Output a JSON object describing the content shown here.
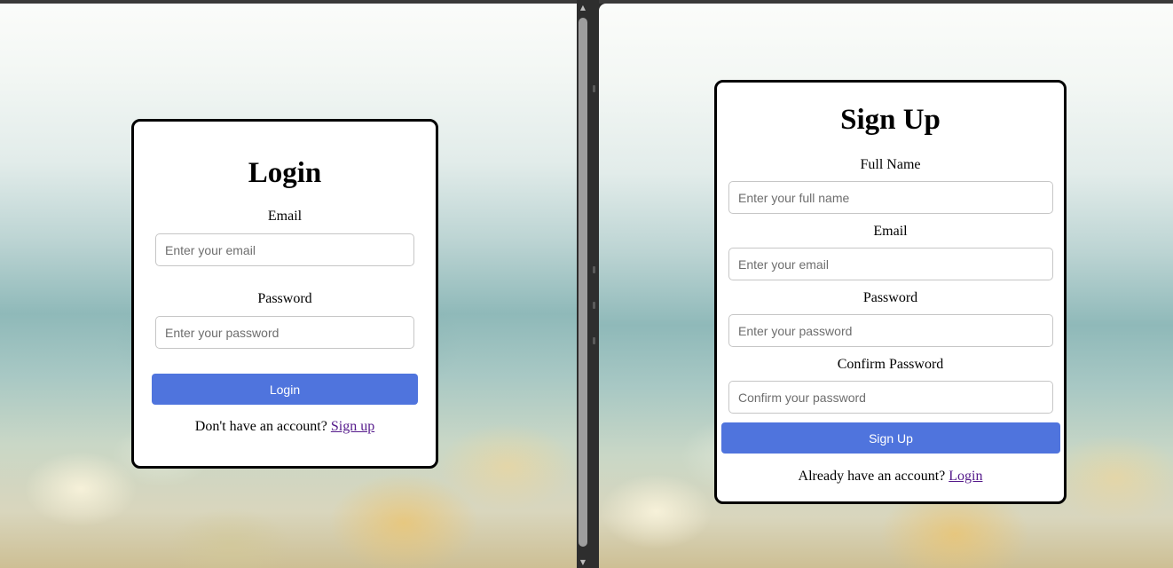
{
  "login": {
    "title": "Login",
    "email_label": "Email",
    "email_placeholder": "Enter your email",
    "password_label": "Password",
    "password_placeholder": "Enter your password",
    "button_label": "Login",
    "footer_text": "Don't have an account?",
    "footer_link": "Sign up"
  },
  "signup": {
    "title": "Sign Up",
    "fullname_label": "Full Name",
    "fullname_placeholder": "Enter your full name",
    "email_label": "Email",
    "email_placeholder": "Enter your email",
    "password_label": "Password",
    "password_placeholder": "Enter your password",
    "confirm_label": "Confirm Password",
    "confirm_placeholder": "Confirm your password",
    "button_label": "Sign Up",
    "footer_text": "Already have an account?",
    "footer_link": "Login"
  },
  "colors": {
    "button_blue": "#4f74dd",
    "link_visited": "#551a8b",
    "card_border": "#000000"
  },
  "icons": {
    "scroll_up": "scroll-up-arrow-icon",
    "scroll_down": "scroll-down-arrow-icon"
  }
}
